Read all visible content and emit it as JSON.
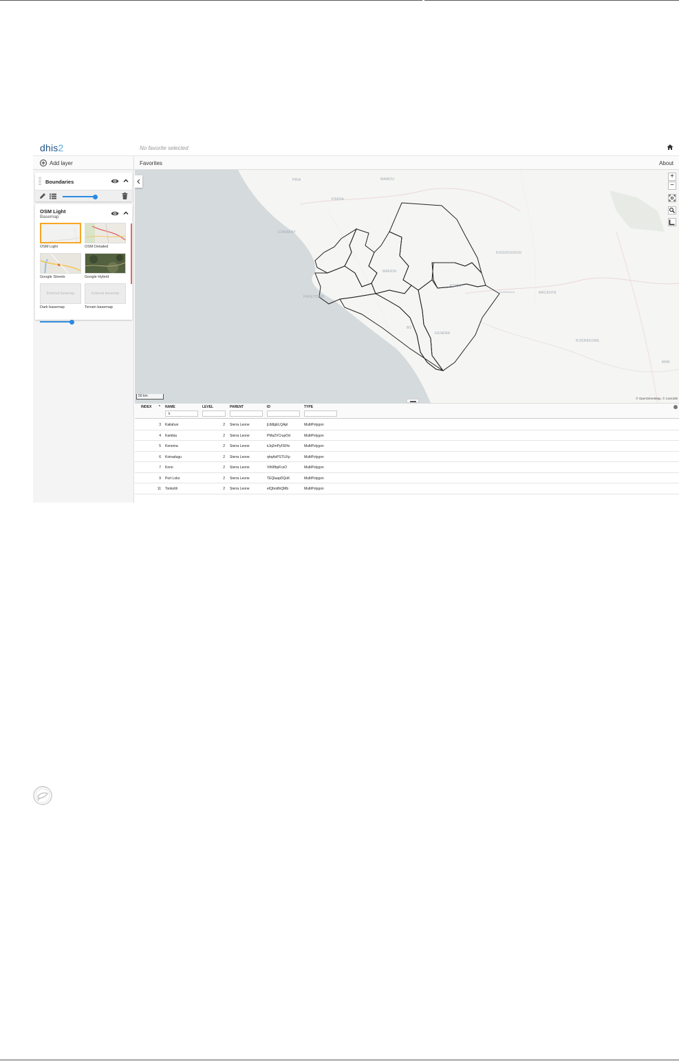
{
  "header": {
    "logo_main": "dhis",
    "logo_accent": "2",
    "favorite_title": "No favorite selected"
  },
  "toolbar": {
    "add_layer": "Add layer",
    "favorites": "Favorites",
    "about": "About"
  },
  "layers": {
    "boundaries": {
      "title": "Boundaries",
      "opacity": 0.95
    },
    "basemap": {
      "title": "OSM Light",
      "subtitle": "Basemap",
      "opacity": 0.92,
      "options": [
        {
          "label": "OSM Light",
          "selected": true
        },
        {
          "label": "OSM Detailed"
        },
        {
          "label": "Google Streets"
        },
        {
          "label": "Google Hybrid"
        },
        {
          "label": "Dark basemap",
          "placeholder": "External basemap"
        },
        {
          "label": "Terrain basemap",
          "placeholder": "External basemap"
        }
      ]
    }
  },
  "map": {
    "scale_label": "50 km",
    "attribution": "© OpenStreetMap, © CartoDB",
    "zoom_in": "+",
    "zoom_out": "−",
    "labels": {
      "pria": "PRIA",
      "mamou": "MAMOU",
      "kindia": "KINDIA",
      "conakry": "CONAKRY",
      "kissidougou": "KISSIDOUGOU",
      "makeni": "MAKENI",
      "koidu": "KOIDU",
      "freetown": "FREETOWN",
      "gueckedou": "Guéckédou",
      "macenta": "MACENTA",
      "bo": "BO",
      "kenema": "KENEMA",
      "nzerekore": "N'ZÉRÉKORÉ",
      "man": "MAN"
    }
  },
  "table": {
    "headers": {
      "index": "INDEX",
      "sort": "*",
      "name": "NAME",
      "level": "LEVEL",
      "parent": "PARENT",
      "id": "ID",
      "type": "TYPE"
    },
    "filters": {
      "name": "k"
    },
    "rows": [
      {
        "index": "3",
        "name": "Kailahun",
        "level": "2",
        "parent": "Sierra Leone",
        "id": "jUb8gELQApl",
        "type": "MultiPolygon"
      },
      {
        "index": "4",
        "name": "Kambia",
        "level": "2",
        "parent": "Sierra Leone",
        "id": "PMa2VCrupOd",
        "type": "MultiPolygon"
      },
      {
        "index": "5",
        "name": "Kenema",
        "level": "2",
        "parent": "Sierra Leone",
        "id": "kJq2mPyFEHo",
        "type": "MultiPolygon"
      },
      {
        "index": "6",
        "name": "Koinadugu",
        "level": "2",
        "parent": "Sierra Leone",
        "id": "qhqAxPSTUXp",
        "type": "MultiPolygon"
      },
      {
        "index": "7",
        "name": "Kono",
        "level": "2",
        "parent": "Sierra Leone",
        "id": "Vth0fbpFcsO",
        "type": "MultiPolygon"
      },
      {
        "index": "9",
        "name": "Port Loko",
        "level": "2",
        "parent": "Sierra Leone",
        "id": "TEQlaapDQoK",
        "type": "MultiPolygon"
      },
      {
        "index": "11",
        "name": "Tonkolili",
        "level": "2",
        "parent": "Sierra Leone",
        "id": "eIQbndfxQMb",
        "type": "MultiPolygon"
      }
    ]
  }
}
